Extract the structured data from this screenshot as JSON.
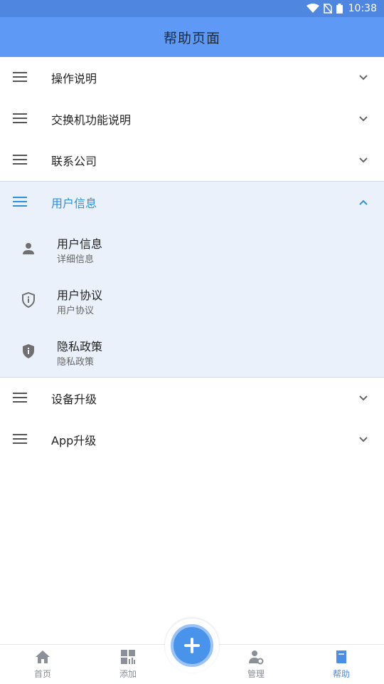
{
  "status_bar": {
    "time": "10:38"
  },
  "header": {
    "title": "帮助页面"
  },
  "menu": {
    "items": [
      {
        "label": "操作说明"
      },
      {
        "label": "交换机功能说明"
      },
      {
        "label": "联系公司"
      },
      {
        "label": "用户信息",
        "expanded": true
      },
      {
        "label": "设备升级"
      },
      {
        "label": "App升级"
      }
    ],
    "user_info_children": [
      {
        "title": "用户信息",
        "desc": "详细信息",
        "icon": "person-icon"
      },
      {
        "title": "用户协议",
        "desc": "用户协议",
        "icon": "shield-info-icon"
      },
      {
        "title": "隐私政策",
        "desc": "隐私政策",
        "icon": "shield-filled-icon"
      }
    ]
  },
  "bottom_nav": {
    "items": [
      {
        "label": "首页",
        "icon": "home-icon"
      },
      {
        "label": "添加",
        "icon": "grid-icon"
      },
      {
        "label": "管理",
        "icon": "user-gear-icon"
      },
      {
        "label": "帮助",
        "icon": "book-icon",
        "active": true
      }
    ],
    "fab_icon": "plus-icon"
  },
  "colors": {
    "accent": "#5e9af5",
    "selected_text": "#2f8fd8",
    "expanded_bg": "#eaf1fb"
  }
}
